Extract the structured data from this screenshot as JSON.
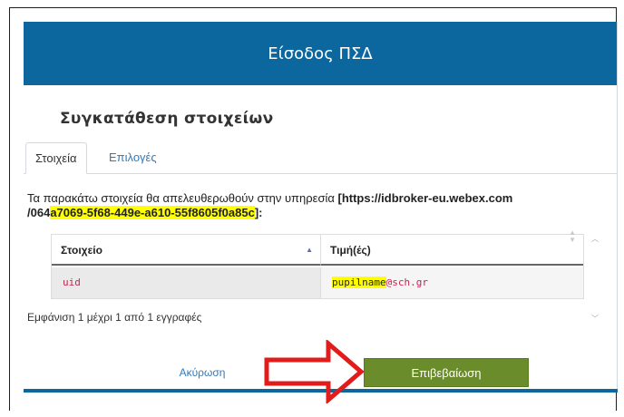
{
  "header": {
    "title": "Είσοδος ΠΣΔ"
  },
  "consent": {
    "heading": "Συγκατάθεση στοιχείων",
    "tabs": [
      {
        "label": "Στοιχεία",
        "active": true
      },
      {
        "label": "Επιλογές",
        "active": false
      }
    ],
    "description_prefix": "Τα παρακάτω στοιχεία θα απελευθερωθούν στην υπηρεσία ",
    "service_part1": "[https://idbroker-eu.webex.com",
    "service_part2": "/064",
    "service_redacted": "a7069-5f68-449e-a610-55f8605f0a85c",
    "service_suffix": "]:",
    "table": {
      "headers": [
        "Στοιχείο",
        "Τιμή(ές)"
      ],
      "rows": [
        {
          "attribute": "uid",
          "value_redacted": "pupilname",
          "value_suffix": "@sch.gr"
        }
      ]
    },
    "info": "Εμφάνιση 1 μέχρι 1 από 1 εγγραφές"
  },
  "actions": {
    "cancel_label": "Ακύρωση",
    "confirm_label": "Επιβεβαίωση"
  },
  "colors": {
    "header_bg": "#0b679e",
    "confirm_bg": "#6a8c2a",
    "annotation_arrow": "#e21b1b",
    "redaction": "#ffff00"
  }
}
